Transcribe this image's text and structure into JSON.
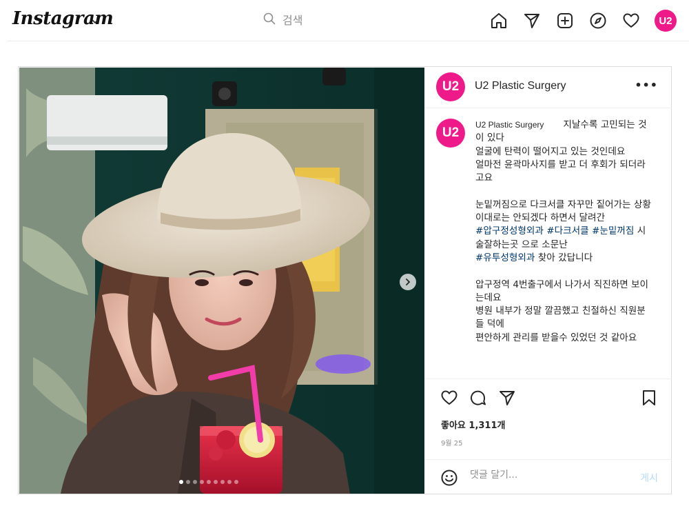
{
  "colors": {
    "brand_pink": "#ee1a8a",
    "link": "#00376b",
    "muted": "#8e8e8e",
    "post_disabled": "#b3dbff"
  },
  "topbar": {
    "logo_text": "Instagram",
    "logo_chevron_icon": "chevron-down-icon",
    "search": {
      "icon": "search-icon",
      "placeholder": "검색"
    },
    "nav": [
      {
        "name": "home",
        "icon": "home-icon"
      },
      {
        "name": "direct",
        "icon": "paper-plane-icon"
      },
      {
        "name": "new-post",
        "icon": "plus-square-icon"
      },
      {
        "name": "explore",
        "icon": "compass-icon"
      },
      {
        "name": "activity",
        "icon": "heart-icon"
      }
    ],
    "profile_avatar_text": "U2"
  },
  "post": {
    "account": {
      "name": "U2 Plastic Surgery",
      "avatar_text": "U2"
    },
    "more_icon": "more-horizontal-icon",
    "more_label": "•••",
    "media": {
      "carousel_count": 9,
      "active_index": 0,
      "next_icon": "chevron-right-icon"
    },
    "caption": {
      "username": "U2 Plastic Surgery",
      "line1": "지날수록 고민되는 것이 있다",
      "line2": "얼굴에 탄력이 떨어지고 있는 것인데요",
      "line3": "얼마전 윤곽마사지를 받고 더 후회가 되더라고요",
      "line4": "눈밑꺼짐으로 다크서클 자꾸만 짙어가는 상황",
      "line5": "이대로는 안되겠다 하면서 달려간",
      "tag1": "#압구정성형외과",
      "tag2": "#다크서클",
      "tag3": "#눈밑꺼짐",
      "line6": " 시술잘하는곳 으로 소문난",
      "tag4": "#유투성형외과",
      "line7": " 찾아 갔답니다",
      "line8": "압구정역 4번출구에서 나가서 직진하면 보이는데요",
      "line9": "병원 내부가 정말 깔끔했고 친절하신 직원분들 덕에",
      "line10": "편안하게 관리를 받을수 있었던 것 같아요"
    },
    "actions": [
      {
        "name": "like",
        "icon": "heart-icon"
      },
      {
        "name": "comment",
        "icon": "comment-icon"
      },
      {
        "name": "share",
        "icon": "paper-plane-icon"
      }
    ],
    "save_icon": "bookmark-icon",
    "likes_text": "좋아요 1,311개",
    "date_text": "9월 25",
    "comment": {
      "emoji_icon": "smiley-icon",
      "placeholder": "댓글 달기...",
      "post_label": "게시"
    }
  }
}
